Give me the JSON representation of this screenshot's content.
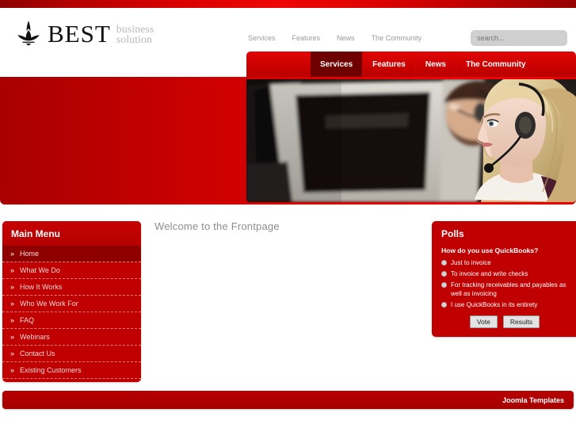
{
  "brand": {
    "name": "BEST",
    "tagline_line1": "business",
    "tagline_line2": "solution",
    "logo_icon": "lotus-emblem-icon"
  },
  "topnav": {
    "items": [
      {
        "label": "Services"
      },
      {
        "label": "Features"
      },
      {
        "label": "News"
      },
      {
        "label": "The Community"
      }
    ]
  },
  "search": {
    "placeholder": "search...",
    "value": ""
  },
  "mainmenu": {
    "items": [
      {
        "label": "Services",
        "active": true
      },
      {
        "label": "Features",
        "active": false
      },
      {
        "label": "News",
        "active": false
      },
      {
        "label": "The Community",
        "active": false
      }
    ]
  },
  "hero": {
    "image_alt": "call-center-agent-with-headset-photo"
  },
  "sidebar": {
    "title": "Main Menu",
    "bullet": "»",
    "items": [
      {
        "label": "Home",
        "active": true
      },
      {
        "label": "What We Do",
        "active": false
      },
      {
        "label": "How It Works",
        "active": false
      },
      {
        "label": "Who We Work For",
        "active": false
      },
      {
        "label": "FAQ",
        "active": false
      },
      {
        "label": "Webinars",
        "active": false
      },
      {
        "label": "Contact Us",
        "active": false
      },
      {
        "label": "Existing Customers",
        "active": false
      }
    ]
  },
  "content": {
    "heading": "Welcome to the Frontpage"
  },
  "polls": {
    "title": "Polls",
    "question": "How do you use QuickBooks?",
    "options": [
      {
        "label": "Just to invoice",
        "selected": false
      },
      {
        "label": "To invoice and write checks",
        "selected": false
      },
      {
        "label": "For tracking receivables and payables as well as invoicing",
        "selected": false
      },
      {
        "label": "I use QuickBooks in its entirety",
        "selected": false
      }
    ],
    "vote_label": "Vote",
    "results_label": "Results"
  },
  "footer": {
    "link_label": "Joomla Templates"
  },
  "colors": {
    "brand_red": "#c00000",
    "bright_red": "#ee0606",
    "dark_red": "#6e0000",
    "footer_red": "#b70000",
    "muted_text": "#9a9a9a"
  }
}
